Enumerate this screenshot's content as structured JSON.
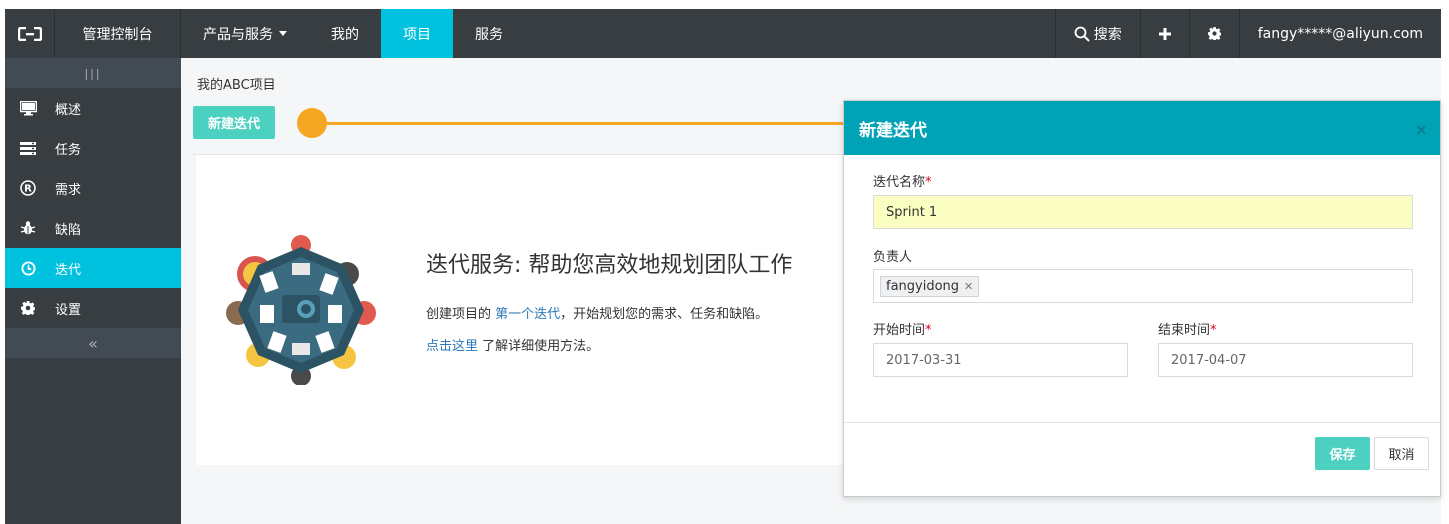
{
  "topbar": {
    "console": "管理控制台",
    "nav": [
      {
        "label": "产品与服务",
        "dropdown": true
      },
      {
        "label": "我的"
      },
      {
        "label": "项目",
        "active": true
      },
      {
        "label": "服务"
      }
    ],
    "search": "搜索",
    "user": "fangy*****@aliyun.com"
  },
  "sidebar": {
    "items": [
      {
        "label": "概述",
        "icon": "monitor-icon"
      },
      {
        "label": "任务",
        "icon": "tasks-icon"
      },
      {
        "label": "需求",
        "icon": "registered-icon"
      },
      {
        "label": "缺陷",
        "icon": "bug-icon"
      },
      {
        "label": "迭代",
        "icon": "clock-icon",
        "active": true
      },
      {
        "label": "设置",
        "icon": "gear-icon"
      }
    ],
    "collapse_top": "|||",
    "collapse_bottom": "«"
  },
  "main": {
    "breadcrumb": "我的ABC项目",
    "new_button": "新建迭代",
    "card": {
      "title": "迭代服务: 帮助您高效地规划团队工作",
      "line1_prefix": "创建项目的 ",
      "line1_link": "第一个迭代",
      "line1_suffix": "，开始规划您的需求、任务和缺陷。",
      "line2_link": "点击这里",
      "line2_suffix": " 了解详细使用方法。"
    }
  },
  "modal": {
    "title": "新建迭代",
    "close": "×",
    "name_label": "迭代名称",
    "name_value": "Sprint 1",
    "owner_label": "负责人",
    "owner_tag": "fangyidong",
    "start_label": "开始时间",
    "start_value": "2017-03-31",
    "end_label": "结束时间",
    "end_value": "2017-04-07",
    "required_mark": "*",
    "save": "保存",
    "cancel": "取消"
  },
  "colors": {
    "topbar": "#373d41",
    "accent": "#00c1de",
    "modal_header": "#00a2b5",
    "button": "#4cd1c1",
    "timeline": "#f5a623"
  }
}
